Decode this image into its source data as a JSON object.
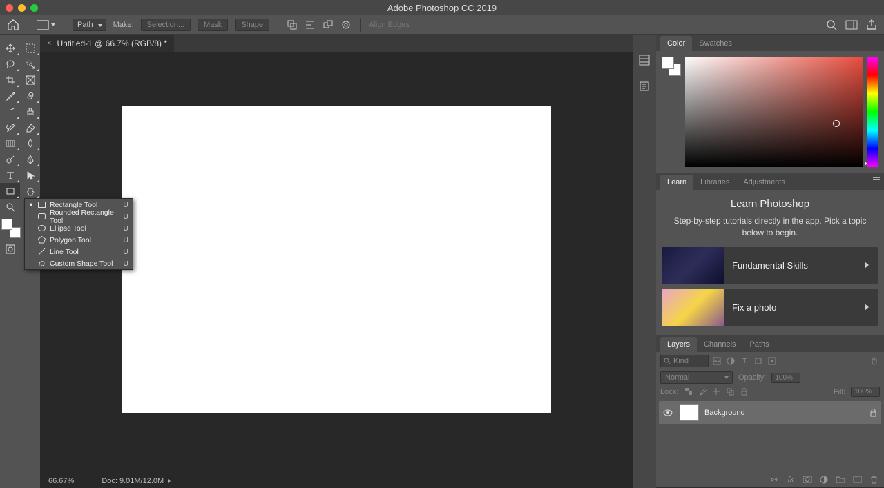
{
  "app_title": "Adobe Photoshop CC 2019",
  "options_bar": {
    "mode_select": "Path",
    "make_label": "Make:",
    "selection_btn": "Selection...",
    "mask_btn": "Mask",
    "shape_btn": "Shape",
    "align_edges": "Align Edges"
  },
  "document": {
    "tab_title": "Untitled-1 @ 66.7% (RGB/8) *",
    "zoom": "66.67%",
    "doc_info": "Doc: 9.01M/12.0M"
  },
  "flyout": {
    "items": [
      {
        "label": "Rectangle Tool",
        "key": "U",
        "active": true
      },
      {
        "label": "Rounded Rectangle Tool",
        "key": "U"
      },
      {
        "label": "Ellipse Tool",
        "key": "U"
      },
      {
        "label": "Polygon Tool",
        "key": "U"
      },
      {
        "label": "Line Tool",
        "key": "U"
      },
      {
        "label": "Custom Shape Tool",
        "key": "U"
      }
    ]
  },
  "panels": {
    "color_tab": "Color",
    "swatches_tab": "Swatches",
    "learn_tab": "Learn",
    "libraries_tab": "Libraries",
    "adjustments_tab": "Adjustments",
    "layers_tab": "Layers",
    "channels_tab": "Channels",
    "paths_tab": "Paths"
  },
  "learn": {
    "title": "Learn Photoshop",
    "subtitle": "Step-by-step tutorials directly in the app. Pick a topic below to begin.",
    "card1": "Fundamental Skills",
    "card2": "Fix a photo"
  },
  "layers": {
    "kind_label": "Kind",
    "blend_mode": "Normal",
    "opacity_label": "Opacity:",
    "opacity_val": "100%",
    "lock_label": "Lock:",
    "fill_label": "Fill:",
    "fill_val": "100%",
    "bg_layer": "Background"
  }
}
